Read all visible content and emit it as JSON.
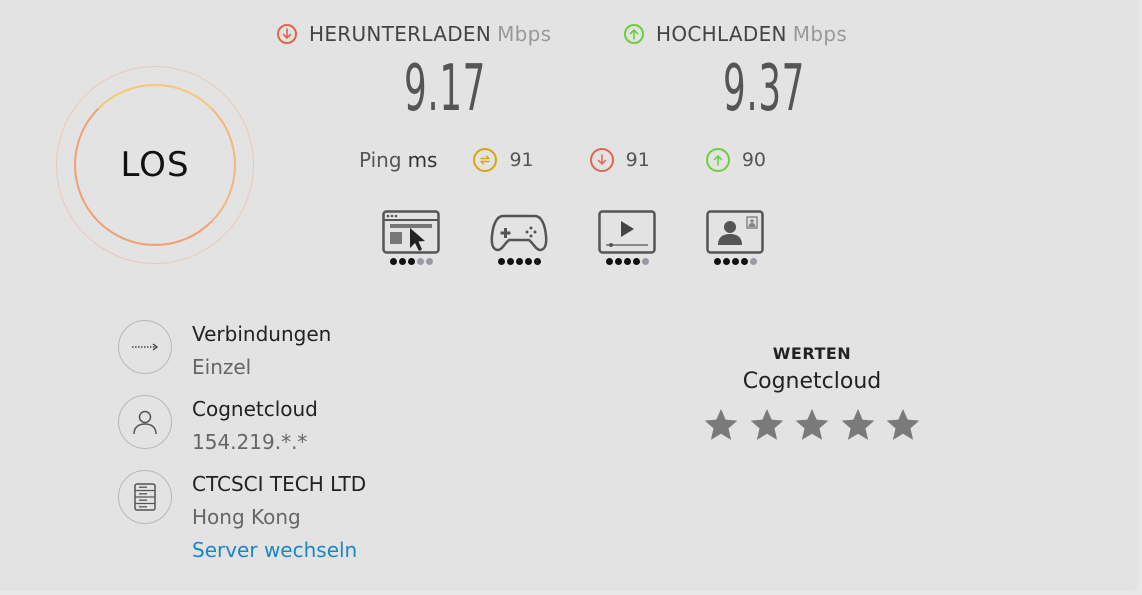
{
  "go_button": {
    "label": "LOS"
  },
  "download": {
    "label": "HERUNTERLADEN",
    "unit": "Mbps",
    "value": "9.17"
  },
  "upload": {
    "label": "HOCHLADEN",
    "unit": "Mbps",
    "value": "9.37"
  },
  "ping": {
    "label": "Ping",
    "unit": "ms",
    "idle": "91",
    "download": "91",
    "upload": "90"
  },
  "usage_ratings": [
    {
      "icon": "web-browsing-icon",
      "score": 3,
      "max": 5
    },
    {
      "icon": "gaming-icon",
      "score": 5,
      "max": 5
    },
    {
      "icon": "video-streaming-icon",
      "score": 4,
      "max": 5
    },
    {
      "icon": "video-chat-icon",
      "score": 4,
      "max": 5
    }
  ],
  "connections": {
    "title": "Verbindungen",
    "value": "Einzel"
  },
  "provider": {
    "name": "Cognetcloud",
    "ip": "154.219.*.*"
  },
  "server": {
    "name": "CTCSCI TECH LTD",
    "location": "Hong Kong",
    "change_link": "Server wechseln"
  },
  "rating": {
    "title": "WERTEN",
    "provider": "Cognetcloud",
    "stars": 5
  },
  "colors": {
    "download": "#e0664f",
    "upload": "#6bcf3c",
    "ping": "#d4a80c",
    "link": "#1a86c8"
  }
}
